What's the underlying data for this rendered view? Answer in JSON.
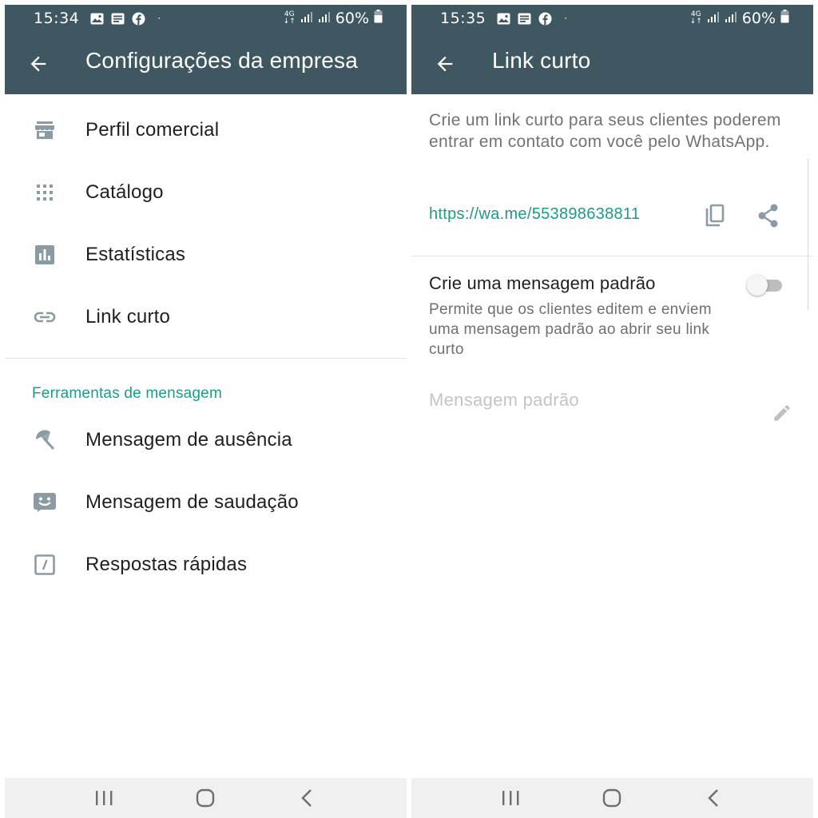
{
  "left_screen": {
    "status_bar": {
      "time": "15:34",
      "network": "4G",
      "battery": "60%",
      "dot": "·"
    },
    "app_bar": {
      "title": "Configurações da empresa",
      "back_icon": "arrow-back-icon"
    },
    "items": [
      {
        "label": "Perfil comercial",
        "icon": "storefront-icon"
      },
      {
        "label": "Catálogo",
        "icon": "grid-dots-icon"
      },
      {
        "label": "Estatísticas",
        "icon": "bar-chart-icon"
      },
      {
        "label": "Link curto",
        "icon": "link-icon"
      }
    ],
    "section_title": "Ferramentas de mensagem",
    "tools": [
      {
        "label": "Mensagem de ausência",
        "icon": "beach-umbrella-icon"
      },
      {
        "label": "Mensagem de saudação",
        "icon": "smile-message-icon"
      },
      {
        "label": "Respostas rápidas",
        "icon": "quick-reply-icon"
      }
    ]
  },
  "right_screen": {
    "status_bar": {
      "time": "15:35",
      "network": "4G",
      "battery": "60%",
      "dot": "·"
    },
    "app_bar": {
      "title": "Link curto",
      "back_icon": "arrow-back-icon"
    },
    "description": "Crie um link curto para seus clientes poderem entrar em contato com você pelo WhatsApp.",
    "link": "https://wa.me/553898638811",
    "default_message": {
      "title": "Crie uma mensagem padrão",
      "subtitle": "Permite que os clientes editem e enviem uma mensagem padrão ao abrir seu link curto",
      "enabled": false,
      "placeholder": "Mensagem padrão"
    }
  },
  "colors": {
    "app_bar": "#3f5761",
    "accent": "#1a9c87",
    "icon_gray": "#8a9ba3",
    "nav_bar": "#f0f0f0"
  }
}
